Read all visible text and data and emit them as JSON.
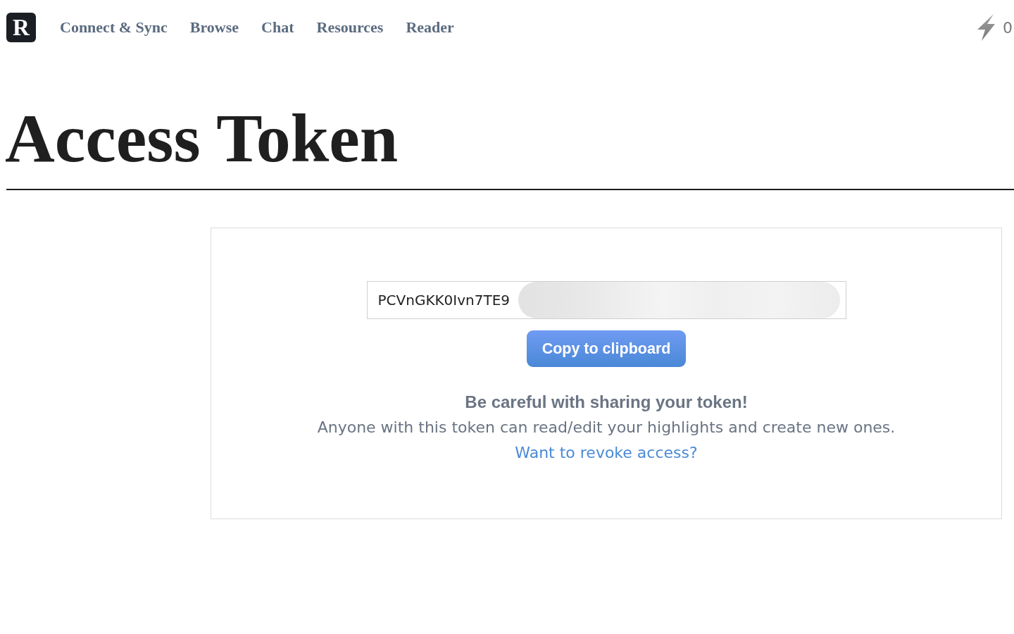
{
  "header": {
    "logo_letter": "R",
    "links": [
      {
        "label": "Connect & Sync"
      },
      {
        "label": "Browse"
      },
      {
        "label": "Chat"
      },
      {
        "label": "Resources"
      },
      {
        "label": "Reader"
      }
    ],
    "counter": "0"
  },
  "page_title": "Access Token",
  "token_card": {
    "token": {
      "value": "PCVnGKK0Ivn7TE9",
      "obscured": true
    },
    "copy_button": "Copy to clipboard",
    "warning_title": "Be careful with sharing your token!",
    "warning_text": "Anyone with this token can read/edit your highlights and create new ones.",
    "revoke_link": "Want to revoke access?"
  }
}
